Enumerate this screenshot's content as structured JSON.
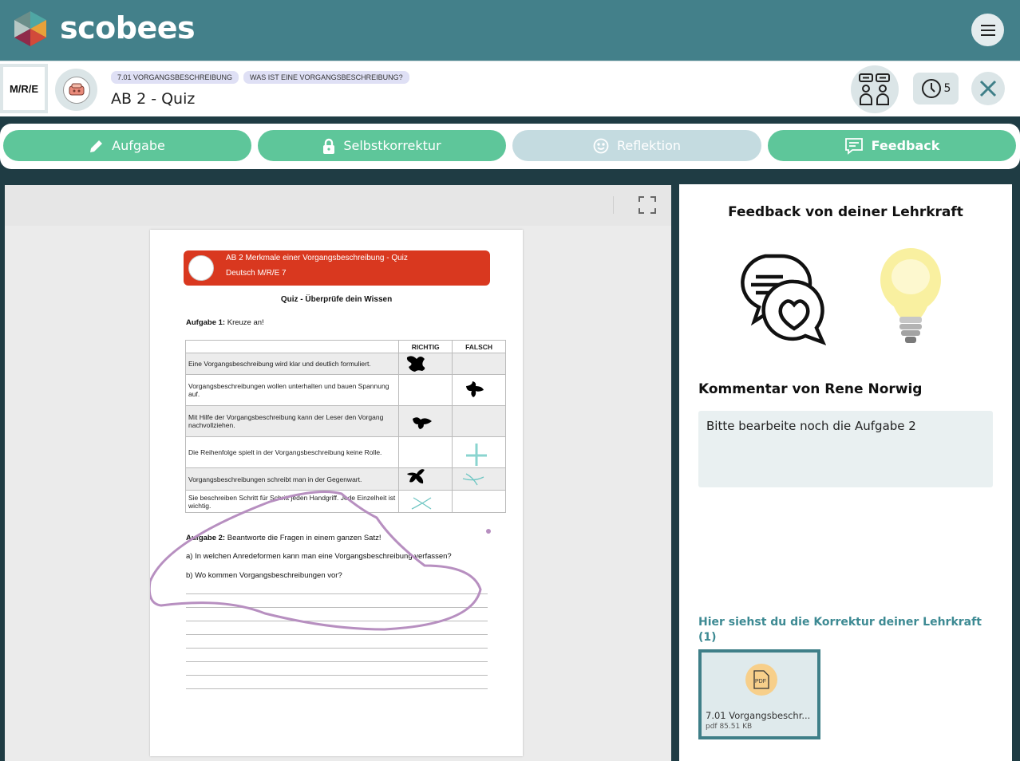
{
  "app": {
    "brand": "scobees"
  },
  "header": {
    "subject": "M/R/E",
    "crumbs": [
      "7.01 VORGANGSBESCHREIBUNG",
      "WAS IST EINE VORGANGSBESCHREIBUNG?"
    ],
    "title": "AB 2 - Quiz",
    "time_count": "5"
  },
  "tabs": [
    {
      "label": "Aufgabe",
      "icon": "pencil-icon",
      "state": "active"
    },
    {
      "label": "Selbstkorrektur",
      "icon": "lock-icon",
      "state": "active"
    },
    {
      "label": "Reflektion",
      "icon": "smiley-icon",
      "state": "disabled"
    },
    {
      "label": "Feedback",
      "icon": "comment-icon",
      "state": "selected"
    }
  ],
  "document": {
    "header_line1": "AB 2 Merkmale einer Vorgangsbeschreibung - Quiz",
    "header_line2": "Deutsch M/R/E 7",
    "quiz_title": "Quiz - Überprüfe dein Wissen",
    "task1_label": "Aufgabe 1:",
    "task1_text": " Kreuze an!",
    "col_richtig": "RICHTIG",
    "col_falsch": "FALSCH",
    "rows": [
      "Eine Vorgangsbeschreibung wird klar und deutlich formuliert.",
      "Vorgangsbeschreibungen wollen unterhalten und bauen Spannung auf.",
      "Mit Hilfe der Vorgangsbeschreibung kann der Leser den Vorgang nachvollziehen.",
      "Die Reihenfolge spielt in der Vorgangsbeschreibung keine Rolle.",
      "Vorgangsbeschreibungen schreibt man in der Gegenwart.",
      "Sie beschreiben Schritt für Schritt jeden Handgriff. Jede Einzelheit ist wichtig."
    ],
    "task2_label": "Aufgabe 2:",
    "task2_text": " Beantworte die Fragen in einem ganzen Satz!",
    "question_a": "a)   In welchen Anredeformen kann man eine Vorgangsbeschreibung verfassen?",
    "question_b": "b)   Wo kommen Vorgangsbeschreibungen vor?"
  },
  "feedback": {
    "title": "Feedback von deiner Lehrkraft",
    "comment_title": "Kommentar von Rene Norwig",
    "comment_text": "Bitte bearbeite noch die Aufgabe 2",
    "correction_title": "Hier siehst du die Korrektur deiner Lehrkraft (1)",
    "file_icon_label": "PDF",
    "file_name": "7.01 Vorgangsbeschr...",
    "file_meta": "pdf 85.51 KB"
  },
  "colors": {
    "topbar": "#43808a",
    "tab_active": "#5ec69a",
    "tab_disabled": "#c4dbe0",
    "doc_header": "#d9381f",
    "link": "#3d8a93",
    "annotation": "#b78fc0"
  }
}
